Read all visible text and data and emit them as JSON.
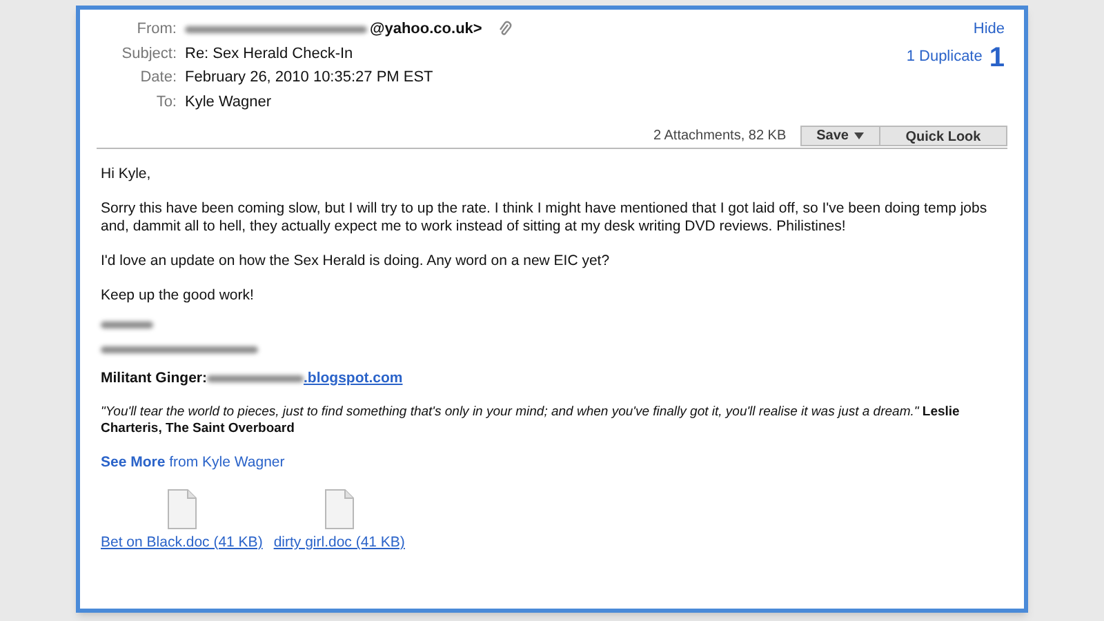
{
  "header": {
    "fields": [
      {
        "label": "From:",
        "value": "@yahoo.co.uk>",
        "redacted": true,
        "attachment_icon": true
      },
      {
        "label": "Subject:",
        "value": "Re: Sex Herald Check-In",
        "redacted": false,
        "attachment_icon": false
      },
      {
        "label": "Date:",
        "value": "February 26, 2010 10:35:27 PM EST",
        "redacted": false,
        "attachment_icon": false
      },
      {
        "label": "To:",
        "value": "Kyle Wagner",
        "redacted": false,
        "attachment_icon": false
      }
    ],
    "hide": "Hide",
    "duplicate": "1 Duplicate",
    "duplicate_count": "1"
  },
  "attachments_bar": {
    "summary": "2 Attachments, 82 KB",
    "save": "Save",
    "quick_look": "Quick Look"
  },
  "body": {
    "paragraphs": [
      "Hi Kyle,",
      "Sorry this have been coming slow, but I will try to up the rate. I think I might have mentioned that I got laid off, so I've been doing temp jobs and, dammit all to hell, they actually expect me to work instead of sitting at my desk writing DVD reviews. Philistines!",
      "I'd love an update on how the Sex Herald is doing. Any word on a new EIC yet?",
      "Keep up the good work!"
    ],
    "signature_label": "Militant Ginger:",
    "signature_link": ".blogspot.com",
    "quote": "*\"You'll tear the world to pieces, just to find something that's only in your mind; and when you've finally got it, you'll realise it was just a dream.\"* **Leslie Charteris, The Saint Overboard**",
    "see_more": "**See More** from Kyle Wagner"
  },
  "attachments": [
    {
      "name": "Bet on Black.doc (41 KB)"
    },
    {
      "name": "dirty girl.doc (41 KB)"
    }
  ]
}
